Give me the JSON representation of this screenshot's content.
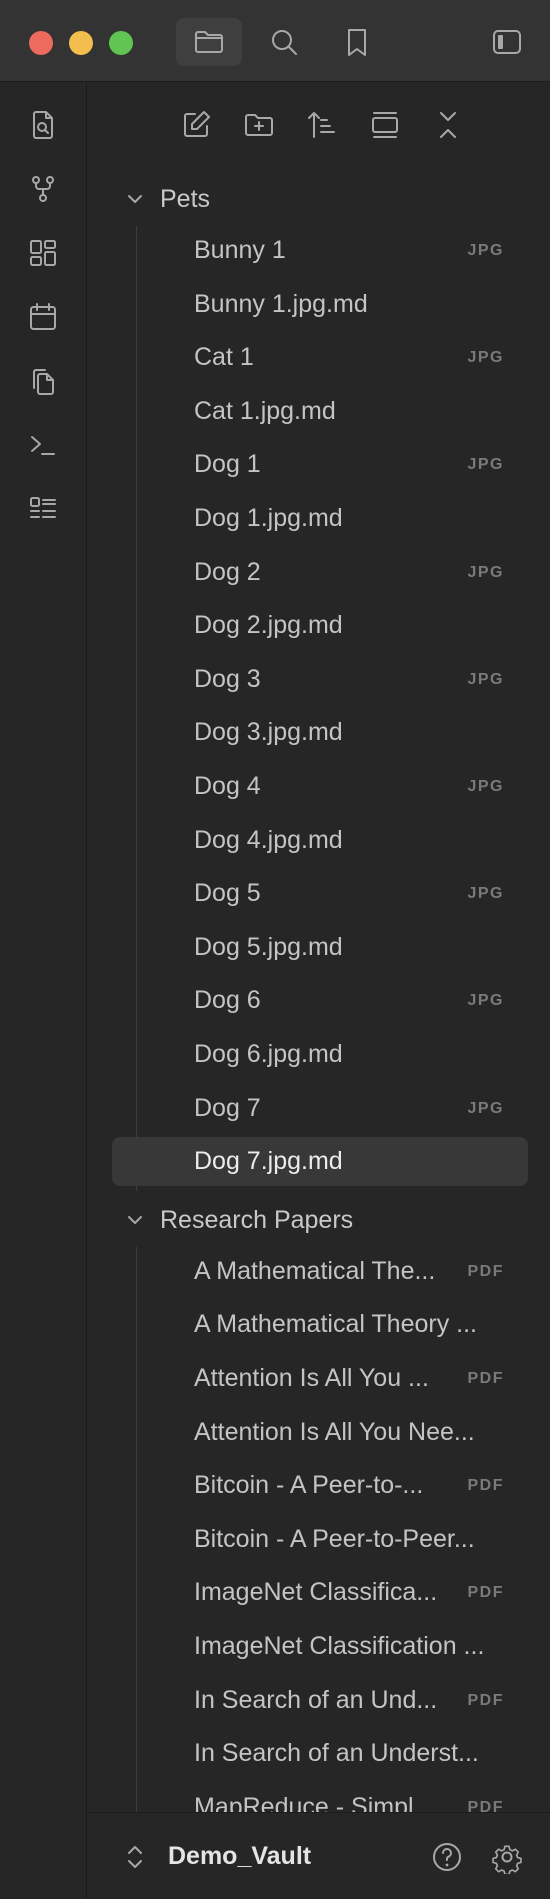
{
  "titlebar": {
    "icons": [
      "close-traffic-light",
      "minimize-traffic-light",
      "zoom-traffic-light",
      "files-icon",
      "search-icon",
      "bookmark-icon",
      "sidebar-toggle-icon"
    ]
  },
  "ribbon": {
    "icons": [
      "open-quick-switcher-icon",
      "graph-view-icon",
      "canvas-icon",
      "daily-note-icon",
      "templates-icon",
      "command-palette-icon",
      "outline-icon"
    ]
  },
  "nav_actions": [
    "new-note-icon",
    "new-folder-icon",
    "sort-icon",
    "auto-reveal-icon",
    "collapse-all-icon"
  ],
  "folders": [
    {
      "name": "Pets",
      "files": [
        {
          "name": "Bunny 1",
          "badge": "JPG"
        },
        {
          "name": "Bunny 1.jpg.md",
          "badge": ""
        },
        {
          "name": "Cat 1",
          "badge": "JPG"
        },
        {
          "name": "Cat 1.jpg.md",
          "badge": ""
        },
        {
          "name": "Dog 1",
          "badge": "JPG"
        },
        {
          "name": "Dog 1.jpg.md",
          "badge": ""
        },
        {
          "name": "Dog 2",
          "badge": "JPG"
        },
        {
          "name": "Dog 2.jpg.md",
          "badge": ""
        },
        {
          "name": "Dog 3",
          "badge": "JPG"
        },
        {
          "name": "Dog 3.jpg.md",
          "badge": ""
        },
        {
          "name": "Dog 4",
          "badge": "JPG"
        },
        {
          "name": "Dog 4.jpg.md",
          "badge": ""
        },
        {
          "name": "Dog 5",
          "badge": "JPG"
        },
        {
          "name": "Dog 5.jpg.md",
          "badge": ""
        },
        {
          "name": "Dog 6",
          "badge": "JPG"
        },
        {
          "name": "Dog 6.jpg.md",
          "badge": ""
        },
        {
          "name": "Dog 7",
          "badge": "JPG"
        },
        {
          "name": "Dog 7.jpg.md",
          "badge": "",
          "selected": true
        }
      ]
    },
    {
      "name": "Research Papers",
      "files": [
        {
          "name": "A Mathematical The...",
          "badge": "PDF"
        },
        {
          "name": "A Mathematical Theory ...",
          "badge": ""
        },
        {
          "name": "Attention Is All You ...",
          "badge": "PDF"
        },
        {
          "name": "Attention Is All You Nee...",
          "badge": ""
        },
        {
          "name": "Bitcoin - A Peer-to-...",
          "badge": "PDF"
        },
        {
          "name": "Bitcoin - A Peer-to-Peer...",
          "badge": ""
        },
        {
          "name": "ImageNet Classifica...",
          "badge": "PDF"
        },
        {
          "name": "ImageNet Classification ...",
          "badge": ""
        },
        {
          "name": "In Search of an Und...",
          "badge": "PDF"
        },
        {
          "name": "In Search of an Underst...",
          "badge": ""
        },
        {
          "name": "MapReduce - Simpl...",
          "badge": "PDF"
        }
      ]
    }
  ],
  "footer": {
    "vault_name": "Demo_Vault",
    "icons": [
      "vault-switcher-icon",
      "help-icon",
      "settings-icon"
    ]
  }
}
